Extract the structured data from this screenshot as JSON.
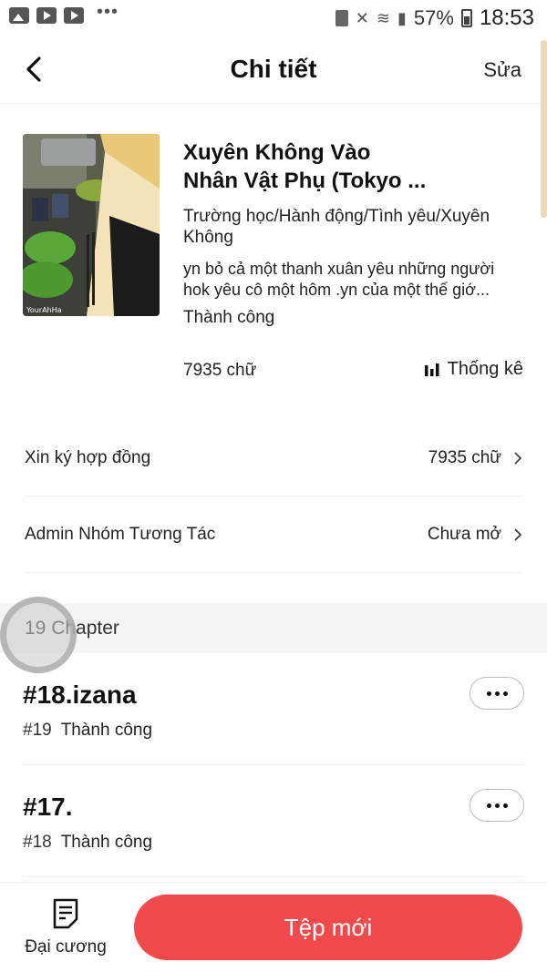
{
  "status_bar": {
    "battery": "57%",
    "time": "18:53",
    "icons": [
      "gallery-icon",
      "youtube-icon",
      "youtube-icon",
      "more-dots-icon",
      "mute-icon",
      "wifi-icon",
      "signal-icon",
      "battery-icon"
    ]
  },
  "header": {
    "title": "Chi tiết",
    "edit_label": "Sửa"
  },
  "book": {
    "title_line1": "Xuyên Không Vào",
    "title_line2": "Nhân Vật Phụ (Tokyo ...",
    "genres": "Trường học/Hành động/Tình yêu/Xuyên Không",
    "desc_line1": "yn bỏ cả một thanh xuân yêu những người",
    "desc_line2": "hok yêu cô một hôm .yn của một thế giớ...",
    "status": "Thành công",
    "word_count": "7935 chữ",
    "stats_label": "Thống kê"
  },
  "rows": [
    {
      "label": "Xin ký hợp đồng",
      "value": "7935 chữ"
    },
    {
      "label": "Admin Nhóm Tương Tác",
      "value": "Chưa mở"
    }
  ],
  "chapters_header": "19 Chapter",
  "chapters": [
    {
      "title": "#18.izana",
      "number": "#19",
      "status": "Thành công"
    },
    {
      "title": "#17.",
      "number": "#18",
      "status": "Thành công"
    }
  ],
  "bottom": {
    "outline_label": "Đại cương",
    "new_file_label": "Tệp mới"
  },
  "colors": {
    "accent": "#f04a4d",
    "section_bg": "#f5f5f5"
  }
}
